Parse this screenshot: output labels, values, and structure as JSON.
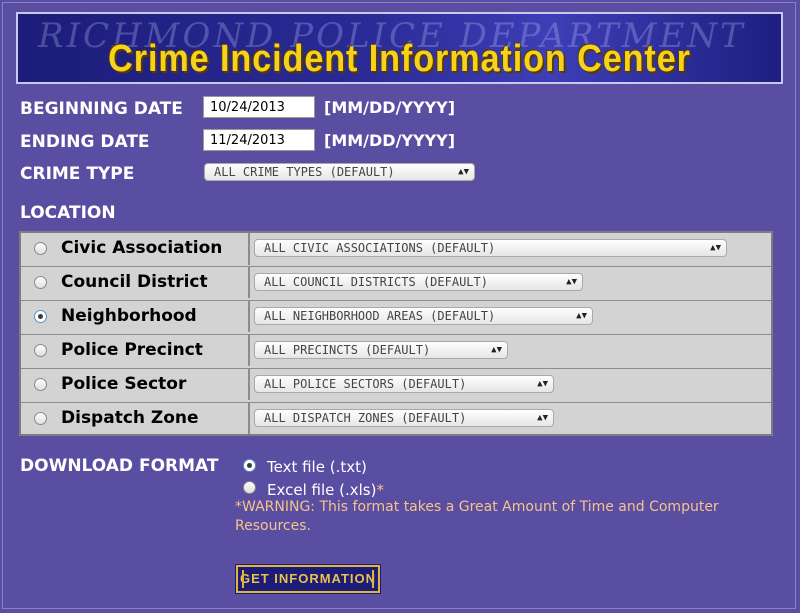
{
  "banner": {
    "subtitle": "RICHMOND POLICE DEPARTMENT",
    "title": "Crime Incident Information Center"
  },
  "form": {
    "beginning_date_label": "BEGINNING DATE",
    "beginning_date_value": "10/24/2013",
    "ending_date_label": "ENDING DATE",
    "ending_date_value": "11/24/2013",
    "date_format_hint": "[MM/DD/YYYY]",
    "crime_type_label": "CRIME TYPE",
    "crime_type_value": "ALL CRIME TYPES (DEFAULT)",
    "location_label": "LOCATION"
  },
  "location_rows": [
    {
      "label": "Civic Association",
      "select": "ALL CIVIC ASSOCIATIONS (DEFAULT)",
      "checked": false
    },
    {
      "label": "Council District",
      "select": "ALL COUNCIL DISTRICTS (DEFAULT)",
      "checked": false
    },
    {
      "label": "Neighborhood",
      "select": "ALL NEIGHBORHOOD AREAS (DEFAULT)",
      "checked": true
    },
    {
      "label": "Police Precinct",
      "select": "ALL PRECINCTS (DEFAULT)",
      "checked": false
    },
    {
      "label": "Police Sector",
      "select": "ALL POLICE SECTORS (DEFAULT)",
      "checked": false
    },
    {
      "label": "Dispatch Zone",
      "select": "ALL DISPATCH ZONES (DEFAULT)",
      "checked": false
    }
  ],
  "download": {
    "label": "DOWNLOAD FORMAT",
    "option_txt": "Text file (.txt)",
    "option_xls": "Excel file (.xls)",
    "option_xls_star": "*",
    "selected": "txt",
    "warning": "*WARNING: This format takes a Great Amount of Time and Computer Resources."
  },
  "submit_label": "GET INFORMATION",
  "colors": {
    "background": "#5a4ea3",
    "banner_title": "#f5d21c",
    "warning": "#f4c48a"
  }
}
